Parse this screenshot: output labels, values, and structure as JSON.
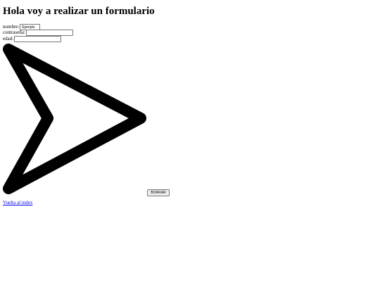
{
  "page": {
    "title": "Hola voy a realizar un formulario"
  },
  "form": {
    "nombre": {
      "label": "nombre:",
      "value": "Ejemplo"
    },
    "contrasena": {
      "label": "contraseña:",
      "value": ""
    },
    "edad": {
      "label": "edad:",
      "value": ""
    },
    "image_icon": "arrow-left-icon",
    "reset_label": "BORRAR"
  },
  "footer": {
    "back_link": "Vuelta al index"
  },
  "colors": {
    "link": "#0000ee",
    "text": "#000000",
    "background": "#ffffff"
  }
}
